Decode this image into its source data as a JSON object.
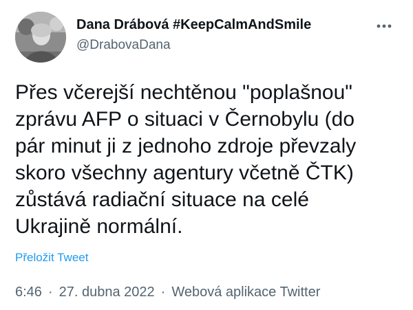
{
  "tweet": {
    "author": {
      "display_name": "Dana Drábová #KeepCalmAndSmile",
      "handle": "@DrabovaDana",
      "avatar_icon": "user-avatar-photo"
    },
    "more_icon": "more-options-icon",
    "text": "Přes včerejší nechtěnou \"poplašnou\"\nzprávu AFP o situaci v Černobylu (do\npár minut ji z jednoho zdroje převzaly\nskoro všechny agentury včetně ČTK)\nzůstává radiační situace na celé\nUkrajině normální.",
    "translate_label": "Přeložit Tweet",
    "time": "6:46",
    "separator1": "·",
    "date": "27. dubna 2022",
    "separator2": "·",
    "source": "Webová aplikace Twitter"
  },
  "colors": {
    "link": "#1d9bf0",
    "secondary_text": "#536471",
    "primary_text": "#0f1419"
  }
}
